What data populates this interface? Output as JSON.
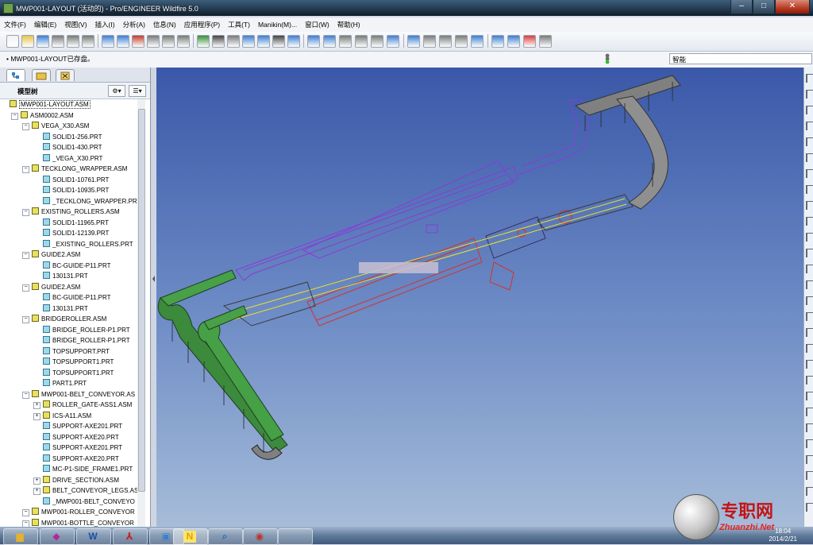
{
  "window": {
    "title": "MWP001-LAYOUT (活动的) - Pro/ENGINEER Wildfire 5.0"
  },
  "menu": [
    "文件(F)",
    "编辑(E)",
    "视图(V)",
    "插入(I)",
    "分析(A)",
    "信息(N)",
    "应用程序(P)",
    "工具(T)",
    "Manikin(M)...",
    "窗口(W)",
    "帮助(H)"
  ],
  "message": "• MWP001-LAYOUT已存盘。",
  "filter": {
    "value": "智能"
  },
  "model_tree": {
    "title": "模型树",
    "items": [
      {
        "label": "MWP001-LAYOUT.ASM",
        "level": 0,
        "type": "asm"
      },
      {
        "label": "ASM0002.ASM",
        "level": 1,
        "type": "asm"
      },
      {
        "label": "VEGA_X30.ASM",
        "level": 2,
        "type": "asm"
      },
      {
        "label": "SOLID1-256.PRT",
        "level": 3,
        "type": "prt"
      },
      {
        "label": "SOLID1-430.PRT",
        "level": 3,
        "type": "prt"
      },
      {
        "label": "_VEGA_X30.PRT",
        "level": 3,
        "type": "prt"
      },
      {
        "label": "TECKLONG_WRAPPER.ASM",
        "level": 2,
        "type": "asm"
      },
      {
        "label": "SOLID1-10761.PRT",
        "level": 3,
        "type": "prt"
      },
      {
        "label": "SOLID1-10935.PRT",
        "level": 3,
        "type": "prt"
      },
      {
        "label": "_TECKLONG_WRAPPER.PRT",
        "level": 3,
        "type": "prt"
      },
      {
        "label": "EXISTING_ROLLERS.ASM",
        "level": 2,
        "type": "asm"
      },
      {
        "label": "SOLID1-11965.PRT",
        "level": 3,
        "type": "prt"
      },
      {
        "label": "SOLID1-12139.PRT",
        "level": 3,
        "type": "prt"
      },
      {
        "label": "_EXISTING_ROLLERS.PRT",
        "level": 3,
        "type": "prt"
      },
      {
        "label": "GUIDE2.ASM",
        "level": 2,
        "type": "asm"
      },
      {
        "label": "BC-GUIDE-P11.PRT",
        "level": 3,
        "type": "prt"
      },
      {
        "label": "130131.PRT",
        "level": 3,
        "type": "prt"
      },
      {
        "label": "GUIDE2.ASM",
        "level": 2,
        "type": "asm"
      },
      {
        "label": "BC-GUIDE-P11.PRT",
        "level": 3,
        "type": "prt"
      },
      {
        "label": "130131.PRT",
        "level": 3,
        "type": "prt"
      },
      {
        "label": "BRIDGEROLLER.ASM",
        "level": 2,
        "type": "asm"
      },
      {
        "label": "BRIDGE_ROLLER-P1.PRT",
        "level": 3,
        "type": "prt"
      },
      {
        "label": "BRIDGE_ROLLER-P1.PRT",
        "level": 3,
        "type": "prt"
      },
      {
        "label": "TOPSUPPORT.PRT",
        "level": 3,
        "type": "prt"
      },
      {
        "label": "TOPSUPPORT1.PRT",
        "level": 3,
        "type": "prt"
      },
      {
        "label": "TOPSUPPORT1.PRT",
        "level": 3,
        "type": "prt"
      },
      {
        "label": "PART1.PRT",
        "level": 3,
        "type": "prt"
      },
      {
        "label": "MWP001-BELT_CONVEYOR.AS",
        "level": 2,
        "type": "asm"
      },
      {
        "label": "ROLLER_GATE-ASS1.ASM",
        "level": 3,
        "type": "asm"
      },
      {
        "label": "ICS-A11.ASM",
        "level": 3,
        "type": "asm"
      },
      {
        "label": "SUPPORT-AXE201.PRT",
        "level": 3,
        "type": "prt"
      },
      {
        "label": "SUPPORT-AXE20.PRT",
        "level": 3,
        "type": "prt"
      },
      {
        "label": "SUPPORT-AXE201.PRT",
        "level": 3,
        "type": "prt"
      },
      {
        "label": "SUPPORT-AXE20.PRT",
        "level": 3,
        "type": "prt"
      },
      {
        "label": "MC-P1-SIDE_FRAME1.PRT",
        "level": 3,
        "type": "prt"
      },
      {
        "label": "DRIVE_SECTION.ASM",
        "level": 3,
        "type": "asm"
      },
      {
        "label": "BELT_CONVEYOR_LEGS.AS",
        "level": 3,
        "type": "asm"
      },
      {
        "label": "_MWP001-BELT_CONVEYO",
        "level": 3,
        "type": "prt"
      },
      {
        "label": "MWP001-ROLLER_CONVEYOR",
        "level": 2,
        "type": "asm"
      },
      {
        "label": "MWP001-BOTTLE_CONVEYOR",
        "level": 2,
        "type": "asm"
      }
    ]
  },
  "taskbar": {
    "time": "18:04",
    "date": "2014/2/21"
  },
  "watermark": {
    "cn": "专职网",
    "en": "Zhuanzhi.Net"
  }
}
